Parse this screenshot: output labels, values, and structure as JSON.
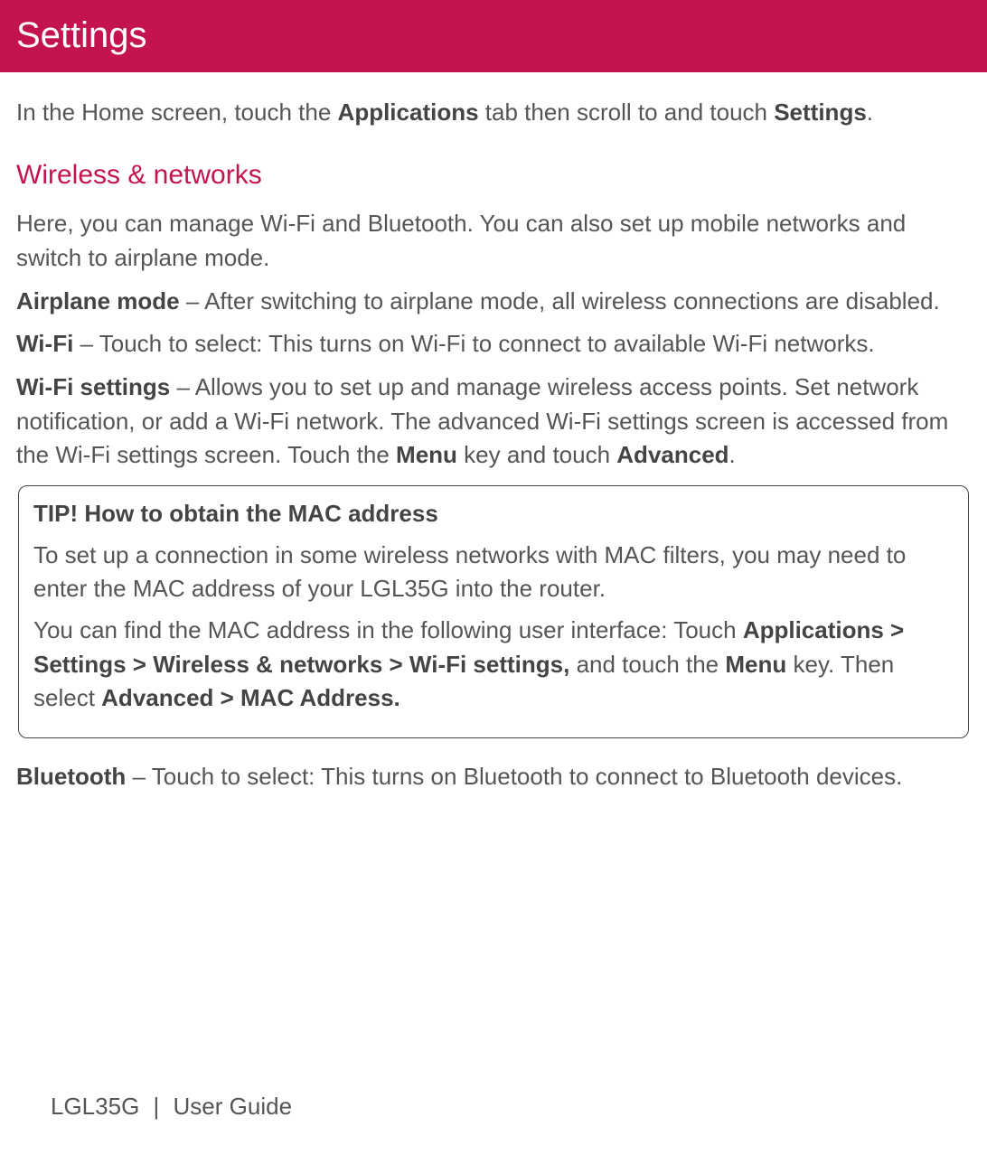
{
  "header": {
    "title": "Settings"
  },
  "intro": {
    "pre": "In the Home screen, touch the ",
    "b1": "Applications",
    "mid": " tab then scroll to and touch ",
    "b2": "Settings",
    "post": "."
  },
  "section": {
    "heading": "Wireless & networks",
    "p1": "Here, you can manage Wi-Fi and Bluetooth. You can also set up mobile networks and switch to airplane mode.",
    "airplane": {
      "label": "Airplane mode",
      "text": " – After switching to airplane mode, all wireless connections are disabled."
    },
    "wifi": {
      "label": "Wi-Fi",
      "text": " – Touch to select: This turns on Wi-Fi to connect to available Wi-Fi networks."
    },
    "wifisettings": {
      "label": "Wi-Fi settings",
      "text1": " – Allows you to set up and manage wireless access points. Set network notification, or add a Wi-Fi network. The advanced Wi-Fi settings screen is accessed from the Wi-Fi settings screen. Touch the ",
      "menu": "Menu",
      "text2": " key and touch ",
      "advanced": "Advanced",
      "text3": "."
    },
    "bluetooth": {
      "label": "Bluetooth",
      "text": " – Touch to select: This turns on Bluetooth to connect to Bluetooth devices."
    }
  },
  "tip": {
    "title": "TIP! How to obtain the MAC address",
    "p1": "To set up a connection in some wireless networks with MAC filters, you may need to enter the MAC address of your LGL35G into the router.",
    "p2a": "You can find the MAC address in the following user interface: Touch ",
    "p2b": "Applications > Settings > Wireless & networks > Wi-Fi settings,",
    "p2c": " and touch the ",
    "p2d": "Menu",
    "p2e": " key. Then select ",
    "p2f": "Advanced > MAC Address."
  },
  "footer": {
    "model": "LGL35G",
    "sep": "|",
    "guide": "User Guide"
  }
}
